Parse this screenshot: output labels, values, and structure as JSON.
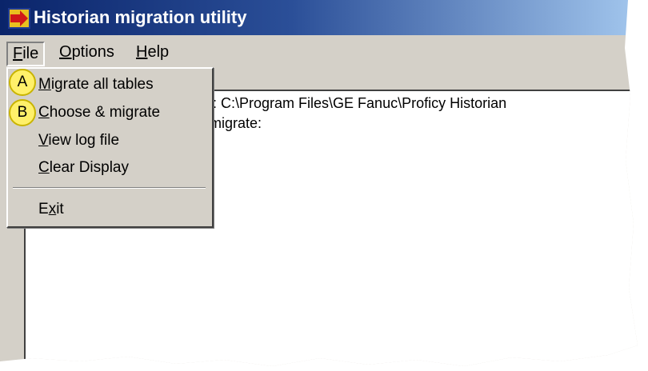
{
  "window": {
    "title": "Historian migration utility"
  },
  "menubar": {
    "file": {
      "hotkey": "F",
      "rest": "ile"
    },
    "options": {
      "hotkey": "O",
      "rest": "ptions"
    },
    "help": {
      "hotkey": "H",
      "rest": "elp"
    }
  },
  "file_menu": {
    "migrate_all": {
      "hotkey": "M",
      "rest": "igrate all tables"
    },
    "choose_migrate": {
      "hotkey": "C",
      "rest": "hoose & migrate"
    },
    "view_log": {
      "hotkey": "V",
      "rest": "iew log file"
    },
    "clear_display": {
      "hotkey": "C",
      "rest": "lear Display"
    },
    "exit": {
      "pre": "E",
      "hotkey": "x",
      "rest": "it"
    }
  },
  "log": {
    "line1": "n: C:\\Program Files\\GE Fanuc\\Proficy Historian",
    "line2": "migrate:"
  },
  "callouts": {
    "a": "A",
    "b": "B"
  },
  "colors": {
    "titlebar_start": "#0a246a",
    "titlebar_end": "#a6caf0",
    "callout": "#fff06a",
    "face": "#d4d0c8"
  },
  "icons": {
    "app": "migration-app-icon"
  }
}
